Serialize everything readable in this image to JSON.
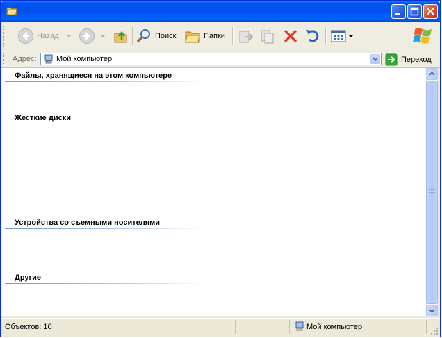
{
  "window": {
    "title": "",
    "icon": "folder-icon"
  },
  "toolbar": {
    "back_label": "Назад",
    "search_label": "Поиск",
    "folders_label": "Папки"
  },
  "address": {
    "label": "Адрес:",
    "value": "Мой компьютер",
    "go_label": "Переход"
  },
  "groups": [
    {
      "title": "Файлы, хранящиеся на этом компьютере"
    },
    {
      "title": "Жесткие диски"
    },
    {
      "title": "Устройства со съемными носителями"
    },
    {
      "title": "Другие"
    }
  ],
  "status": {
    "count": "Объектов: 10",
    "location": "Мой компьютер"
  },
  "colors": {
    "titlebar": "#0053ee",
    "close_button": "#d9492a",
    "window_bg": "#ece9d8"
  }
}
